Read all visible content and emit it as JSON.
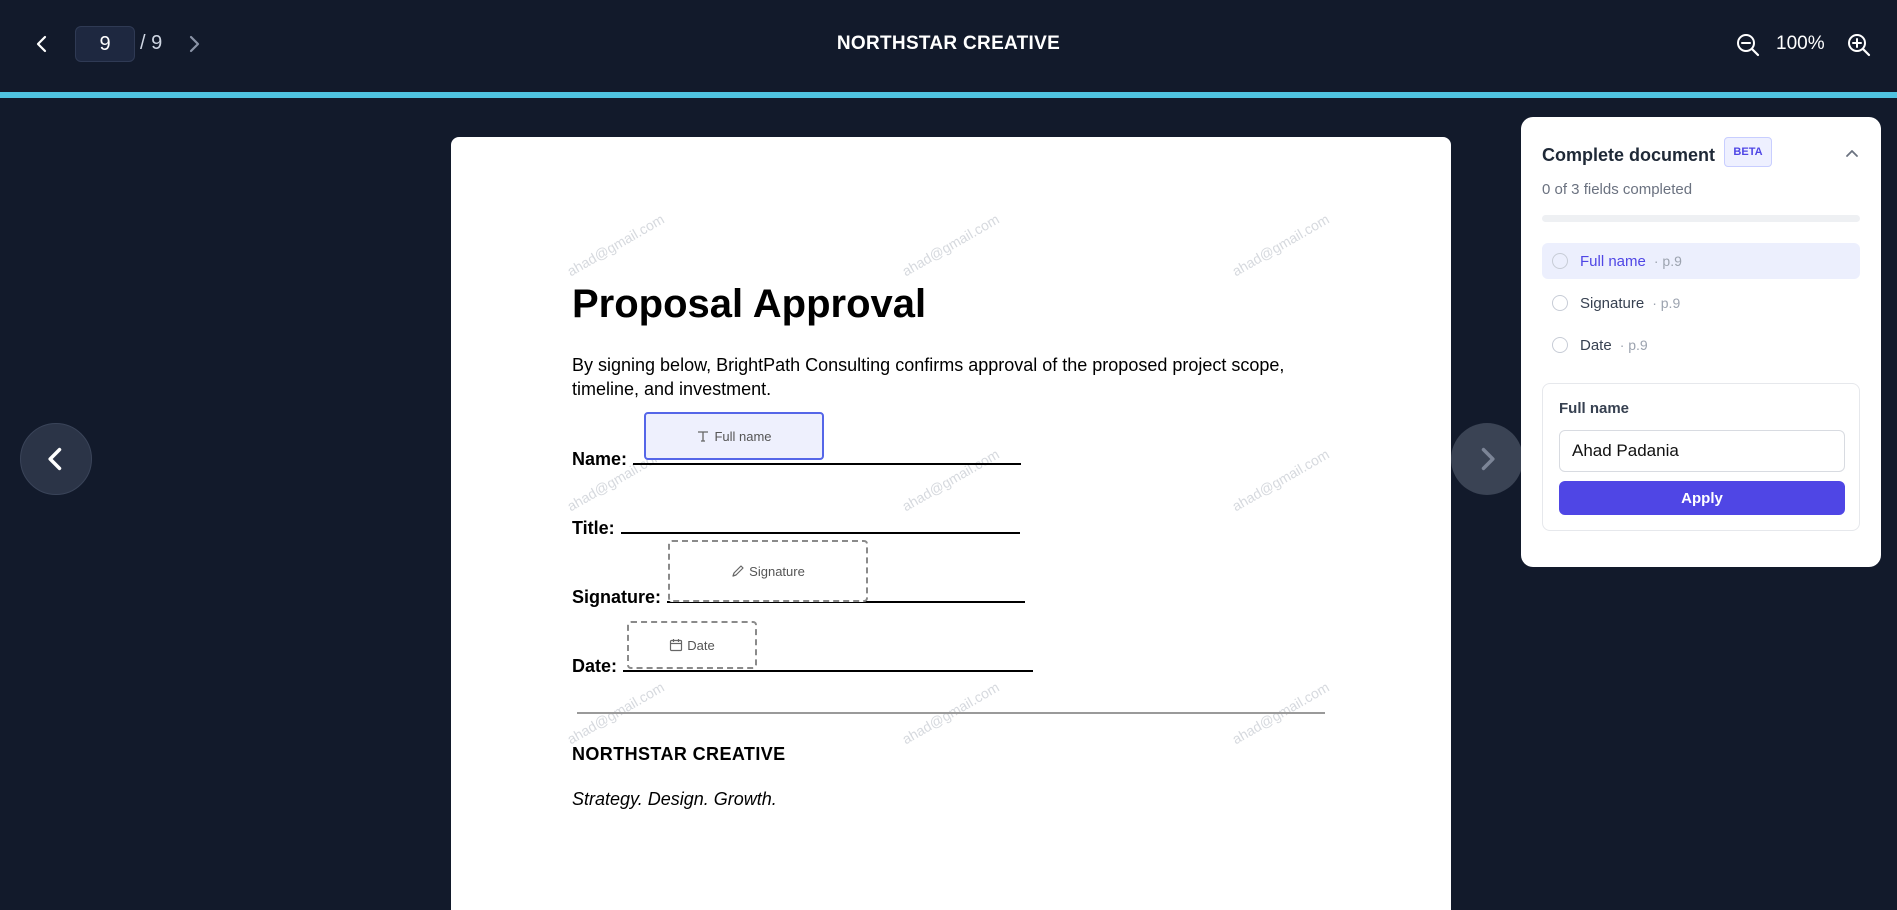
{
  "toolbar": {
    "current_page": "9",
    "total_pages": "/ 9",
    "title": "NORTHSTAR CREATIVE",
    "zoom": "100%"
  },
  "document": {
    "heading": "Proposal Approval",
    "intro": "By signing below, BrightPath Consulting confirms approval of the proposed project scope, timeline, and investment.",
    "name_label": "Name:",
    "title_label": "Title:",
    "signature_label": "Signature:",
    "date_label": "Date:",
    "brand": "NORTHSTAR CREATIVE",
    "tagline": "Strategy. Design. Growth.",
    "watermark": "ahad@gmail.com",
    "fields": {
      "name": "Full name",
      "signature": "Signature",
      "date": "Date"
    }
  },
  "panel": {
    "title": "Complete document",
    "badge": "BETA",
    "progress_text": "0 of 3 fields completed",
    "progress_fraction": 0,
    "items": [
      {
        "label": "Full name",
        "page": "· p.9"
      },
      {
        "label": "Signature",
        "page": "· p.9"
      },
      {
        "label": "Date",
        "page": "· p.9"
      }
    ],
    "editor": {
      "label": "Full name",
      "value": "Ahad Padania",
      "apply": "Apply"
    }
  },
  "colors": {
    "background": "#121a2b",
    "accent_line": "#4fc3e0",
    "primary": "#4f46e5"
  }
}
